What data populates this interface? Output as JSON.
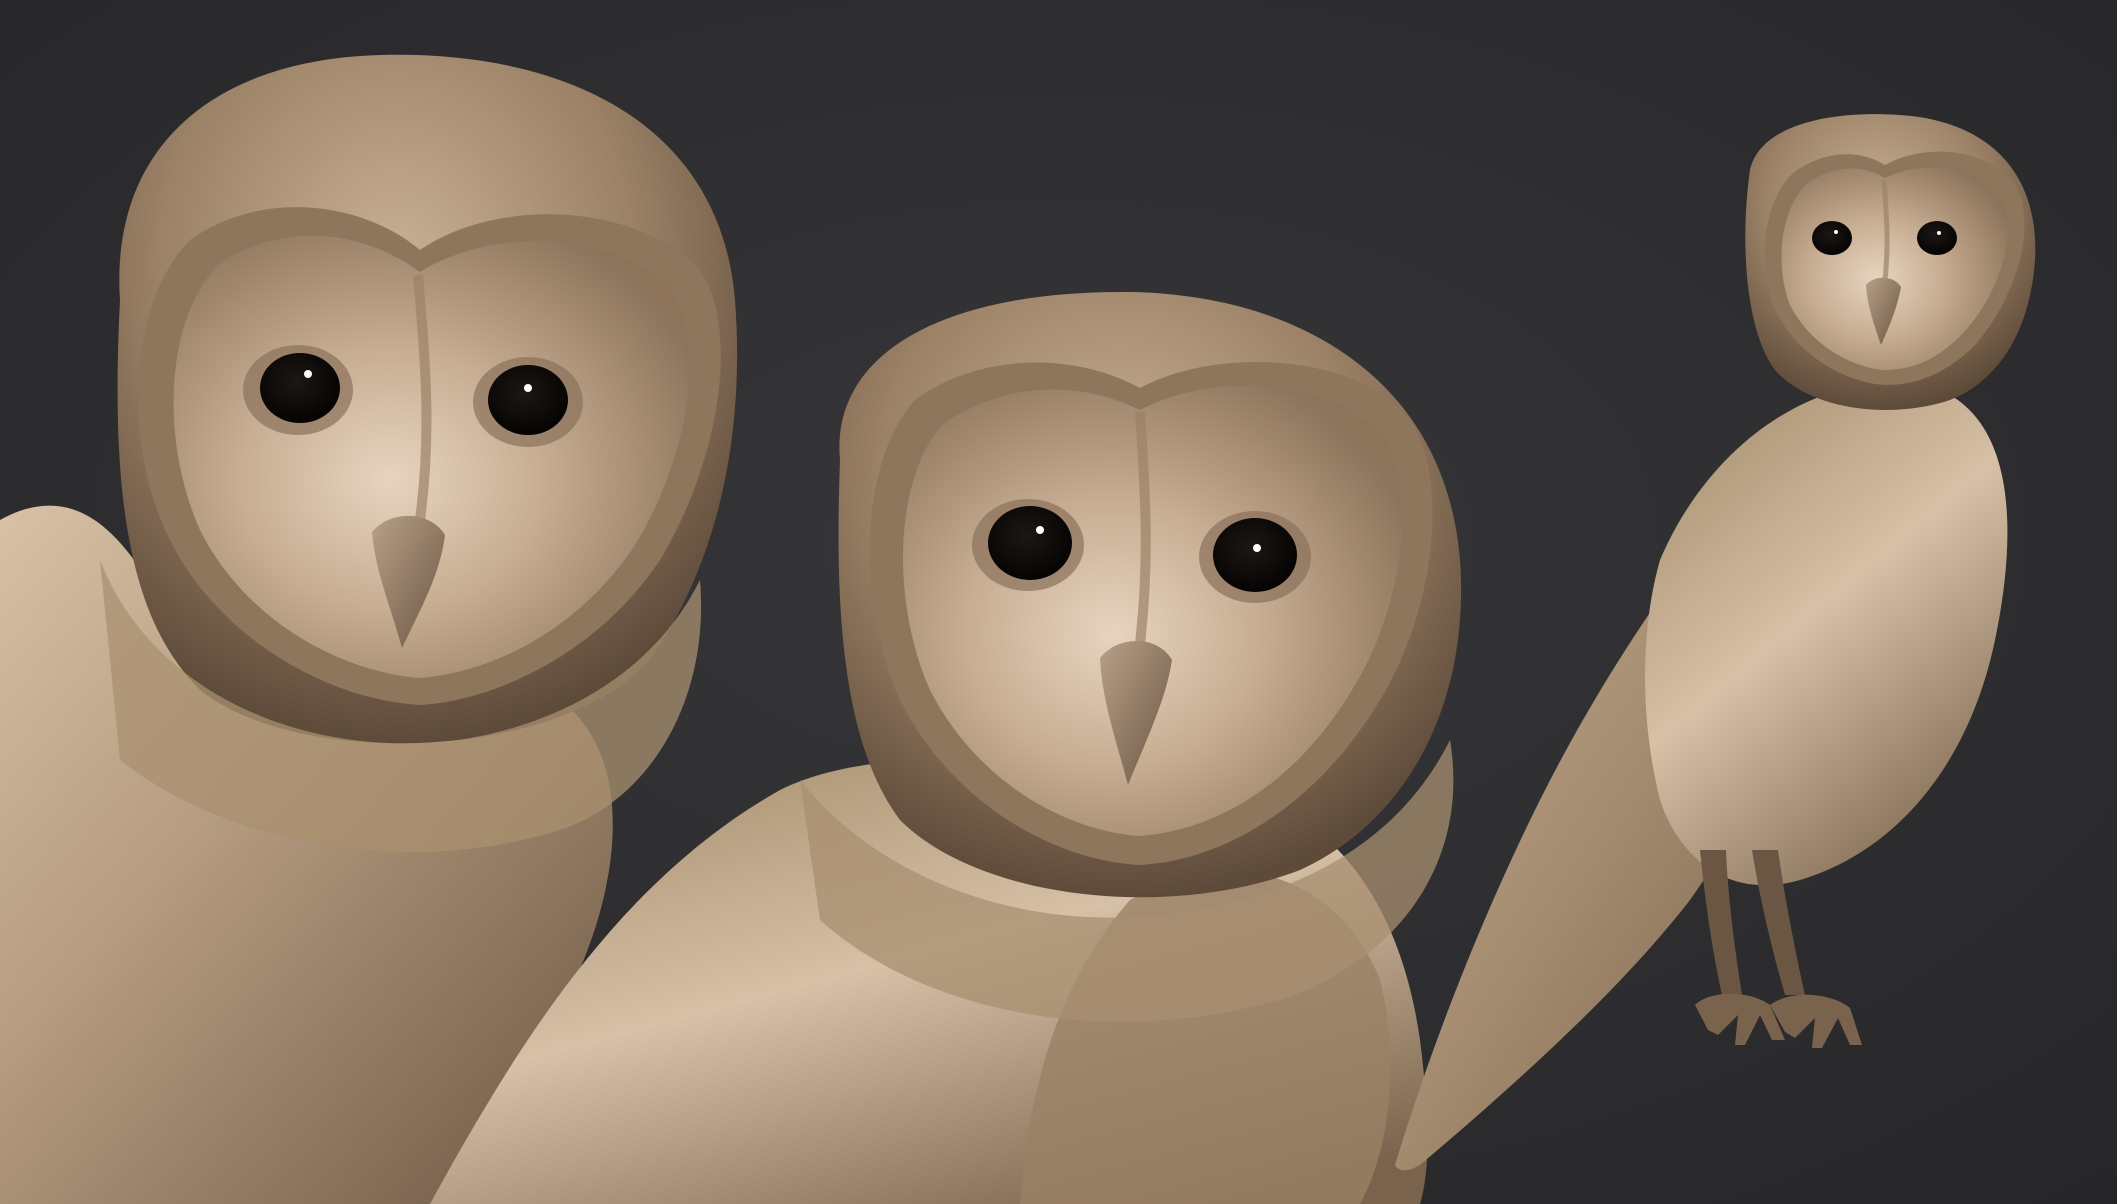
{
  "scene": {
    "subject": "owl-sculpt",
    "views": [
      "close-up-left",
      "close-up-center",
      "full-body-right"
    ]
  },
  "colors": {
    "background": "#2f2f31",
    "clay_light": "#d9c2a8",
    "clay_mid": "#a88e72",
    "clay_dark": "#5d4a39",
    "eye": "#0d0b0a",
    "highlight": "#ffffff"
  }
}
